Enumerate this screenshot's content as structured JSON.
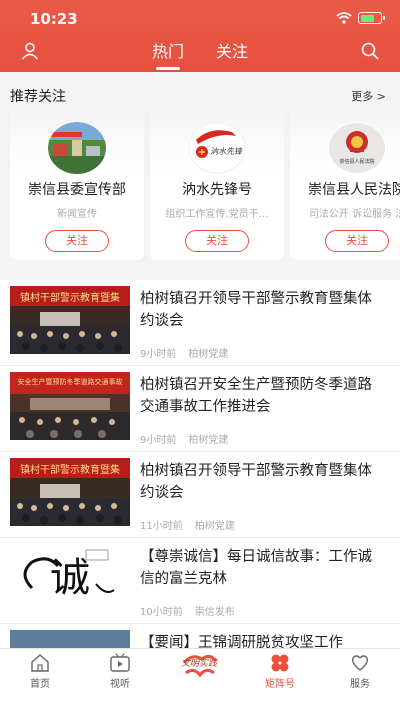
{
  "status": {
    "time": "10:23"
  },
  "header": {
    "tabs": [
      {
        "label": "热门",
        "active": true
      },
      {
        "label": "关注",
        "active": false
      }
    ]
  },
  "recommend": {
    "title": "推荐关注",
    "more": "更多 >",
    "cards": [
      {
        "name": "崇信县委宣传部",
        "desc": "新闻宣传",
        "button": "关注"
      },
      {
        "name": "汭水先锋号",
        "desc": "组织工作宣传,党员干…",
        "button": "关注",
        "logo_text": "汭水先锋"
      },
      {
        "name": "崇信县人民法院",
        "desc": "司法公开 诉讼服务 法",
        "button": "关注",
        "logo_text": "崇信县人民法院"
      }
    ]
  },
  "news": [
    {
      "title": "柏树镇召开领导干部警示教育暨集体约谈会",
      "time": "9小时前",
      "source": "柏树党建",
      "banner": "镇村干部警示教育暨集"
    },
    {
      "title": "柏树镇召开安全生产暨预防冬季道路交通事故工作推进会",
      "time": "9小时前",
      "source": "柏树党建",
      "banner": "安全生产暨预防冬季道路交通事故"
    },
    {
      "title": "柏树镇召开领导干部警示教育暨集体约谈会",
      "time": "11小时前",
      "source": "柏树党建",
      "banner": "镇村干部警示教育暨集"
    },
    {
      "title": "【尊崇诚信】每日诚信故事：工作诚信的富兰克林",
      "time": "10小时前",
      "source": "崇信发布",
      "banner": "诚"
    },
    {
      "title": "【要闻】王锦调研脱贫攻坚工作",
      "time": "",
      "source": "",
      "banner": ""
    }
  ],
  "bottom": {
    "items": [
      {
        "label": "首页",
        "icon": "home-icon"
      },
      {
        "label": "视听",
        "icon": "video-icon"
      },
      {
        "label": "文明实践",
        "icon": "center-logo"
      },
      {
        "label": "矩阵号",
        "icon": "matrix-icon",
        "active": true
      },
      {
        "label": "服务",
        "icon": "service-icon"
      }
    ]
  },
  "colors": {
    "accent": "#e8523f",
    "header": "#e7503e"
  }
}
